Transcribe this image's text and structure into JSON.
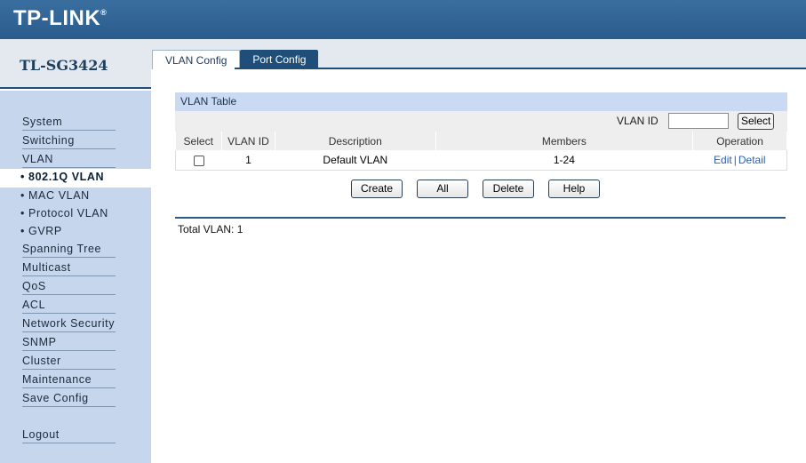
{
  "header": {
    "logo": "TP-LINK",
    "logo_mark": "®"
  },
  "model": "TL-SG3424",
  "tabs": [
    {
      "label": "VLAN Config",
      "active": true
    },
    {
      "label": "Port Config",
      "active": false
    }
  ],
  "sidebar": {
    "items": [
      {
        "label": "System"
      },
      {
        "label": "Switching"
      },
      {
        "label": "VLAN"
      },
      {
        "label": "• 802.1Q VLAN",
        "active": true
      },
      {
        "label": "• MAC VLAN"
      },
      {
        "label": "• Protocol VLAN"
      },
      {
        "label": "• GVRP"
      },
      {
        "label": "Spanning Tree"
      },
      {
        "label": "Multicast"
      },
      {
        "label": "QoS"
      },
      {
        "label": "ACL"
      },
      {
        "label": "Network Security"
      },
      {
        "label": "SNMP"
      },
      {
        "label": "Cluster"
      },
      {
        "label": "Maintenance"
      },
      {
        "label": "Save Config"
      },
      {
        "label": "Logout"
      }
    ]
  },
  "vlan_table": {
    "title": "VLAN Table",
    "search": {
      "label": "VLAN ID",
      "value": "",
      "button": "Select"
    },
    "columns": [
      "Select",
      "VLAN ID",
      "Description",
      "Members",
      "Operation"
    ],
    "rows": [
      {
        "vlan_id": "1",
        "description": "Default VLAN",
        "members": "1-24",
        "edit": "Edit",
        "separator": "|",
        "detail": "Detail",
        "selected": false
      }
    ]
  },
  "actions": {
    "create": "Create",
    "all": "All",
    "delete": "Delete",
    "help": "Help"
  },
  "footer": {
    "total": "Total VLAN: 1"
  },
  "colors": {
    "header": "#2a5b8c",
    "sidebar": "#c5d6ed",
    "panel_title": "#c9daf2",
    "link": "#2b5fb3"
  }
}
